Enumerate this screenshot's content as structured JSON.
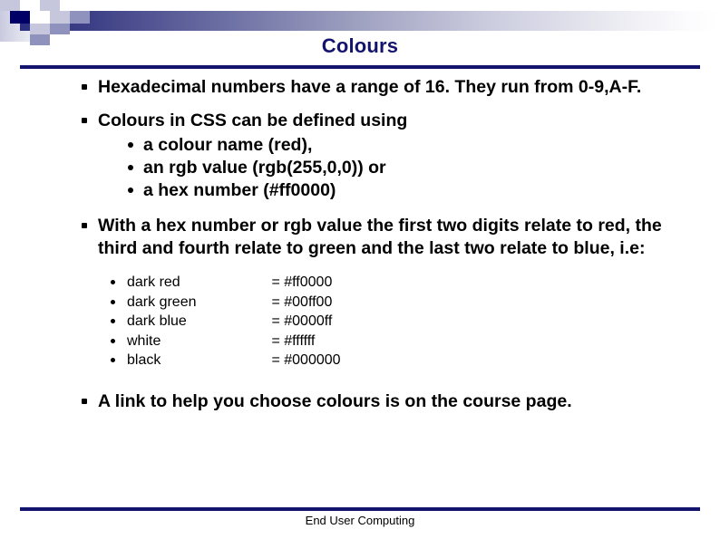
{
  "slide": {
    "title": "Colours",
    "footer": "End User Computing",
    "accent_color": "#14146e",
    "deco_navy": "#000066",
    "deco_mid": "#8f92bd",
    "deco_light": "#c6c7dd"
  },
  "bullets": [
    {
      "level": 1,
      "text": "Hexadecimal numbers have a range of 16. They run from 0-9,A-F."
    },
    {
      "level": 1,
      "text": "Colours in CSS can be defined using"
    },
    {
      "level": 2,
      "text": "a colour name (red),"
    },
    {
      "level": 2,
      "text": "an rgb value (rgb(255,0,0)) or"
    },
    {
      "level": 2,
      "text": "a hex number (#ff0000)"
    },
    {
      "level": 1,
      "text": "With a hex number or rgb value the first two digits relate to red, the third and fourth relate to green and the last two relate to blue, i.e:"
    },
    {
      "level": 1,
      "text": "A link to help you choose colours is on the course page."
    }
  ],
  "colour_table": {
    "rows": [
      {
        "name": "dark red",
        "value": "= #ff0000"
      },
      {
        "name": "dark green",
        "value": "= #00ff00"
      },
      {
        "name": "dark blue",
        "value": "= #0000ff"
      },
      {
        "name": "white",
        "value": "= #ffffff"
      },
      {
        "name": "black",
        "value": "= #000000"
      }
    ]
  }
}
